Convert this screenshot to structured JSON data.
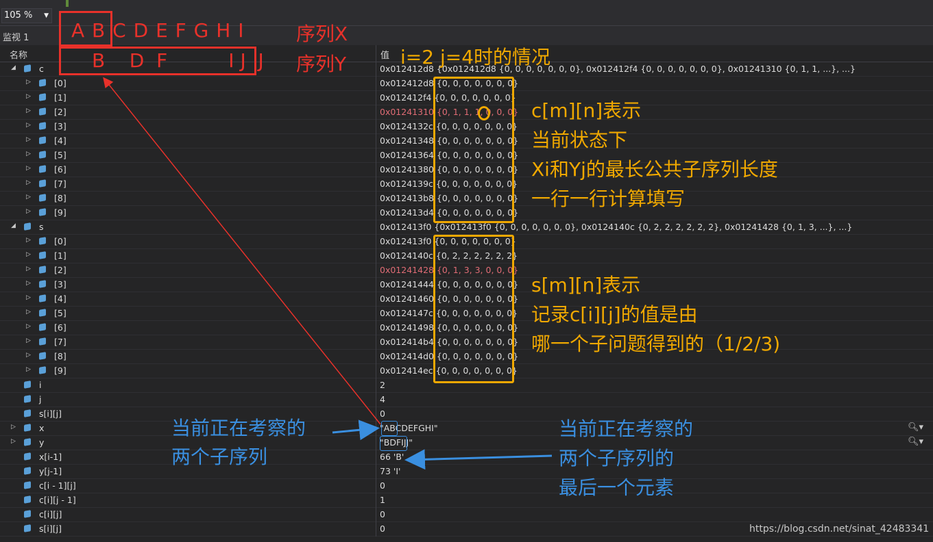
{
  "toolbar": {
    "zoom": "105 %",
    "dropdown_arrow": "▼"
  },
  "panel": {
    "title": "监视 1",
    "col_name": "名称",
    "col_value": "值"
  },
  "rows": [
    {
      "name": "c",
      "value": "0x012412d8 {0x012412d8 {0, 0, 0, 0, 0, 0, 0}, 0x012412f4 {0, 0, 0, 0, 0, 0, 0}, 0x01241310 {0, 1, 1, ...}, ...}"
    },
    {
      "name": "[0]",
      "value": "0x012412d8 {0, 0, 0, 0, 0, 0, 0}"
    },
    {
      "name": "[1]",
      "value": "0x012412f4 {0, 0, 0, 0, 0, 0, 0}"
    },
    {
      "name": "[2]",
      "value": "0x01241310 {0, 1, 1, 1, 0, 0, 0}"
    },
    {
      "name": "[3]",
      "value": "0x0124132c {0, 0, 0, 0, 0, 0, 0}"
    },
    {
      "name": "[4]",
      "value": "0x01241348 {0, 0, 0, 0, 0, 0, 0}"
    },
    {
      "name": "[5]",
      "value": "0x01241364 {0, 0, 0, 0, 0, 0, 0}"
    },
    {
      "name": "[6]",
      "value": "0x01241380 {0, 0, 0, 0, 0, 0, 0}"
    },
    {
      "name": "[7]",
      "value": "0x0124139c {0, 0, 0, 0, 0, 0, 0}"
    },
    {
      "name": "[8]",
      "value": "0x012413b8 {0, 0, 0, 0, 0, 0, 0}"
    },
    {
      "name": "[9]",
      "value": "0x012413d4 {0, 0, 0, 0, 0, 0, 0}"
    },
    {
      "name": "s",
      "value": "0x012413f0 {0x012413f0 {0, 0, 0, 0, 0, 0, 0}, 0x0124140c {0, 2, 2, 2, 2, 2, 2}, 0x01241428 {0, 1, 3, ...}, ...}"
    },
    {
      "name": "[0]",
      "value": "0x012413f0 {0, 0, 0, 0, 0, 0, 0}"
    },
    {
      "name": "[1]",
      "value": "0x0124140c {0, 2, 2, 2, 2, 2, 2}"
    },
    {
      "name": "[2]",
      "value": "0x01241428 {0, 1, 3, 3, 0, 0, 0}"
    },
    {
      "name": "[3]",
      "value": "0x01241444 {0, 0, 0, 0, 0, 0, 0}"
    },
    {
      "name": "[4]",
      "value": "0x01241460 {0, 0, 0, 0, 0, 0, 0}"
    },
    {
      "name": "[5]",
      "value": "0x0124147c {0, 0, 0, 0, 0, 0, 0}"
    },
    {
      "name": "[6]",
      "value": "0x01241498 {0, 0, 0, 0, 0, 0, 0}"
    },
    {
      "name": "[7]",
      "value": "0x012414b4 {0, 0, 0, 0, 0, 0, 0}"
    },
    {
      "name": "[8]",
      "value": "0x012414d0 {0, 0, 0, 0, 0, 0, 0}"
    },
    {
      "name": "[9]",
      "value": "0x012414ec {0, 0, 0, 0, 0, 0, 0}"
    },
    {
      "name": "i",
      "value": "2"
    },
    {
      "name": "j",
      "value": "4"
    },
    {
      "name": "s[i][j]",
      "value": "0"
    },
    {
      "name": "x",
      "value": "\"ABCDEFGHI\""
    },
    {
      "name": "y",
      "value": "\"BDFIJJ\""
    },
    {
      "name": "x[i-1]",
      "value": "66 'B'"
    },
    {
      "name": "y[j-1]",
      "value": "73 'I'"
    },
    {
      "name": "c[i - 1][j]",
      "value": "0"
    },
    {
      "name": "c[i][j - 1]",
      "value": "1"
    },
    {
      "name": "c[i][j]",
      "value": "0"
    },
    {
      "name": "s[i][j]",
      "value": "0"
    }
  ],
  "annotations": {
    "seq_x_letters": "A B C D E F G H I",
    "seq_x_label": "序列X",
    "seq_y_letters": "B    D  F          I J  J",
    "seq_y_label": "序列Y",
    "state_note": "i=2 j=4时的情况",
    "c_note": [
      "c[m][n]表示",
      "当前状态下",
      "Xi和Yj的最长公共子序列长度",
      "一行一行计算填写"
    ],
    "s_note": [
      "s[m][n]表示",
      "记录c[i][j]的值是由",
      "哪一个子问题得到的（1/2/3)"
    ],
    "left_blue": [
      "当前正在考察的",
      "两个子序列"
    ],
    "right_blue": [
      "当前正在考察的",
      "两个子序列的",
      "最后一个元素"
    ]
  },
  "watermark": "https://blog.csdn.net/sinat_42483341",
  "colors": {
    "annotation_red": "#e8312a",
    "annotation_yellow": "#f0a800",
    "annotation_blue": "#3a8fe0",
    "changed_value": "#e06c75"
  }
}
